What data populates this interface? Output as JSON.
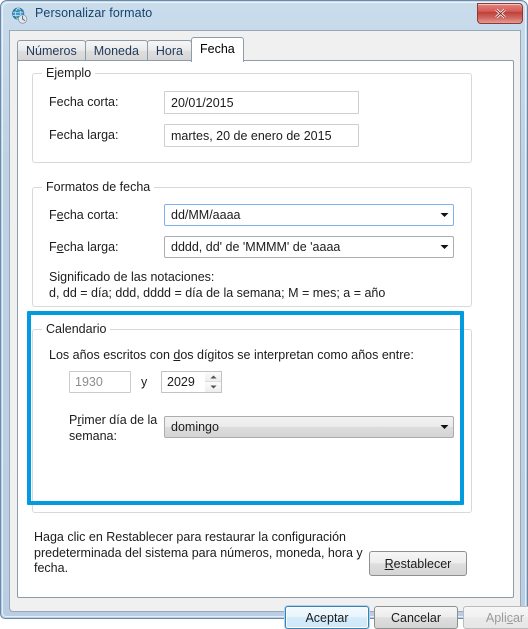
{
  "window": {
    "title": "Personalizar formato",
    "icon": "globe-region-icon",
    "close_label": "Cerrar"
  },
  "tabs": [
    {
      "label": "Números",
      "active": false
    },
    {
      "label": "Moneda",
      "active": false
    },
    {
      "label": "Hora",
      "active": false
    },
    {
      "label": "Fecha",
      "active": true
    }
  ],
  "ejemplo": {
    "legend": "Ejemplo",
    "short_date_label": "Fecha corta:",
    "short_date_value": "20/01/2015",
    "long_date_label": "Fecha larga:",
    "long_date_value": "martes, 20 de enero de 2015"
  },
  "formatos": {
    "legend": "Formatos de fecha",
    "short_date_label_pre": "F",
    "short_date_label_mnemonic": "e",
    "short_date_label_post": "cha corta:",
    "short_date_value": "dd/MM/aaaa",
    "long_date_label_pre": "F",
    "long_date_label_mnemonic": "e",
    "long_date_label_post": "cha larga:",
    "long_date_value": "dddd, dd' de 'MMMM' de 'aaaa",
    "notation_title": "Significado de las notaciones:",
    "notation_body": "d, dd = día;  ddd, dddd = día de la semana; M = mes; a = año"
  },
  "calendario": {
    "legend": "Calendario",
    "two_digit_label_pre": "Los años escritos con ",
    "two_digit_label_mnemonic": "d",
    "two_digit_label_post": "os dígitos se interpretan como años entre:",
    "year_from": "1930",
    "year_from_disabled": true,
    "between_word": "y",
    "year_to": "2029",
    "first_day_label_pre": "P",
    "first_day_label_mnemonic": "r",
    "first_day_label_post": "imer día de la",
    "first_day_label_line2": "semana:",
    "first_day_value": "domingo"
  },
  "footer": {
    "note": "Haga clic en Restablecer para restaurar la configuración\npredeterminada del sistema para números, moneda, hora y\nfecha.",
    "reset_pre": "",
    "reset_mnemonic": "R",
    "reset_post": "establecer"
  },
  "actions": {
    "ok_label": "Aceptar",
    "cancel_label": "Cancelar",
    "apply_pre": "Apli",
    "apply_mnemonic": "c",
    "apply_post": "ar",
    "apply_disabled": true
  },
  "annotation": {
    "highlight_color": "#029cde",
    "target": "calendario-group"
  }
}
